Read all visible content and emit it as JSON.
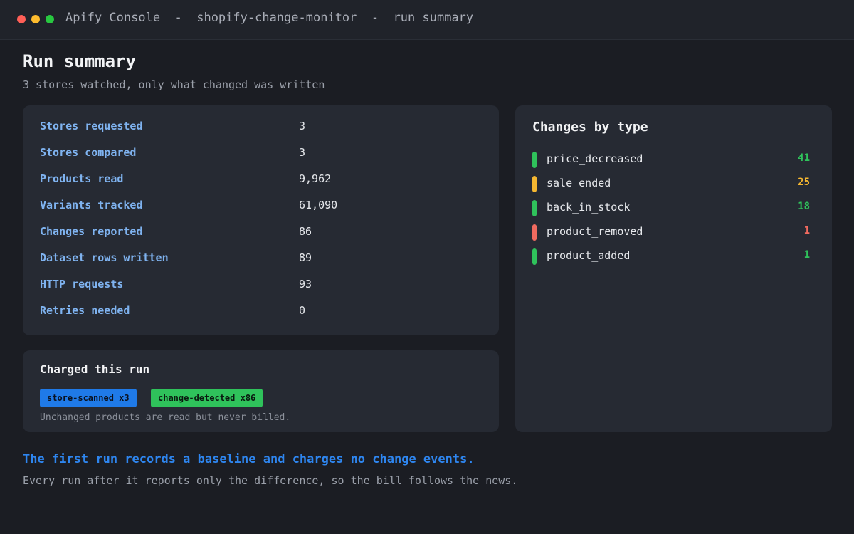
{
  "window": {
    "title": "Apify Console  -  shopify-change-monitor  -  run summary"
  },
  "header": {
    "title": "Run summary",
    "subtitle": "3 stores watched, only what changed was written"
  },
  "stats": [
    {
      "label": "Stores requested",
      "value": "3"
    },
    {
      "label": "Stores compared",
      "value": "3"
    },
    {
      "label": "Products read",
      "value": "9,962"
    },
    {
      "label": "Variants tracked",
      "value": "61,090"
    },
    {
      "label": "Changes reported",
      "value": "86"
    },
    {
      "label": "Dataset rows written",
      "value": "89"
    },
    {
      "label": "HTTP requests",
      "value": "93"
    },
    {
      "label": "Retries needed",
      "value": "0"
    }
  ],
  "charged": {
    "title": "Charged this run",
    "badges": [
      {
        "label": "store-scanned x3",
        "color": "#1f7ae8"
      },
      {
        "label": "change-detected x86",
        "color": "#2fc25b"
      }
    ],
    "note": "Unchanged products are read but never billed."
  },
  "changes": {
    "title": "Changes by type",
    "items": [
      {
        "label": "price_decreased",
        "count": "41",
        "color": "#2fc25b"
      },
      {
        "label": "sale_ended",
        "count": "25",
        "color": "#f5b731"
      },
      {
        "label": "back_in_stock",
        "count": "18",
        "color": "#2fc25b"
      },
      {
        "label": "product_removed",
        "count": "1",
        "color": "#f06a5f"
      },
      {
        "label": "product_added",
        "count": "1",
        "color": "#2fc25b"
      }
    ]
  },
  "footer": {
    "headline": "The first run records a baseline and charges no change events.",
    "text": "Every run after it reports only the difference, so the bill follows the news."
  }
}
